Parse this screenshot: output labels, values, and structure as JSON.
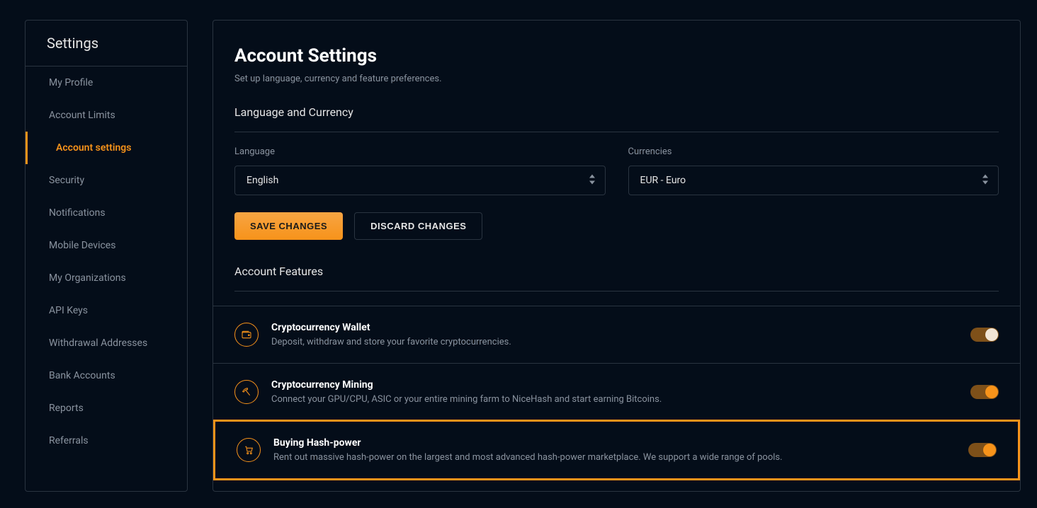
{
  "sidebar": {
    "title": "Settings",
    "items": [
      {
        "label": "My Profile",
        "active": false
      },
      {
        "label": "Account Limits",
        "active": false
      },
      {
        "label": "Account settings",
        "active": true
      },
      {
        "label": "Security",
        "active": false
      },
      {
        "label": "Notifications",
        "active": false
      },
      {
        "label": "Mobile Devices",
        "active": false
      },
      {
        "label": "My Organizations",
        "active": false
      },
      {
        "label": "API Keys",
        "active": false
      },
      {
        "label": "Withdrawal Addresses",
        "active": false
      },
      {
        "label": "Bank Accounts",
        "active": false
      },
      {
        "label": "Reports",
        "active": false
      },
      {
        "label": "Referrals",
        "active": false
      }
    ]
  },
  "page": {
    "title": "Account Settings",
    "subtitle": "Set up language, currency and feature preferences."
  },
  "language_section": {
    "title": "Language and Currency",
    "language_label": "Language",
    "language_value": "English",
    "currency_label": "Currencies",
    "currency_value": "EUR - Euro",
    "save_label": "SAVE CHANGES",
    "discard_label": "DISCARD CHANGES"
  },
  "features_section": {
    "title": "Account Features",
    "items": [
      {
        "icon": "wallet-icon",
        "title": "Cryptocurrency Wallet",
        "desc": "Deposit, withdraw and store your favorite cryptocurrencies.",
        "enabled": true,
        "knob_color": "light",
        "highlighted": false
      },
      {
        "icon": "pickaxe-icon",
        "title": "Cryptocurrency Mining",
        "desc": "Connect your GPU/CPU, ASIC or your entire mining farm to NiceHash and start earning Bitcoins.",
        "enabled": true,
        "knob_color": "orange",
        "highlighted": false
      },
      {
        "icon": "cart-icon",
        "title": "Buying Hash-power",
        "desc": "Rent out massive hash-power on the largest and most advanced hash-power marketplace. We support a wide range of pools.",
        "enabled": true,
        "knob_color": "orange",
        "highlighted": true
      }
    ]
  }
}
